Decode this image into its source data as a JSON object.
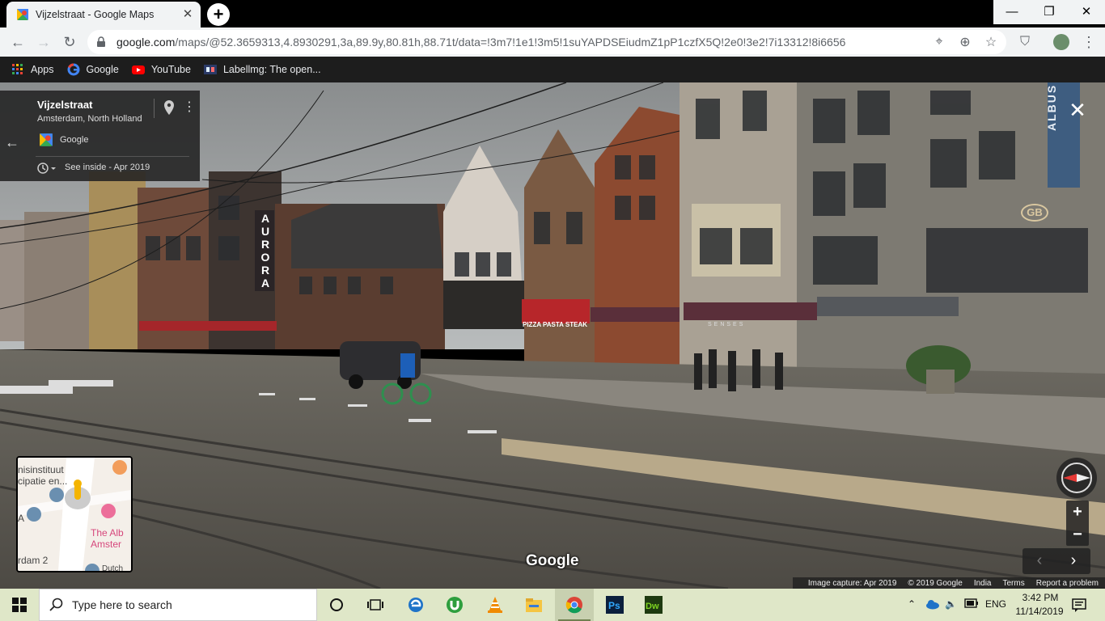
{
  "browser": {
    "tab_title": "Vijzelstraat - Google Maps",
    "tab_close": "✕",
    "new_tab": "+",
    "url_host": "google.com",
    "url_path": "/maps/@52.3659313,4.8930291,3a,89.9y,80.81h,88.71t/data=!3m7!1e1!3m5!1suYAPDSEiudmZ1pP1czfX5Q!2e0!3e2!7i13312!8i6656",
    "window": {
      "minimize": "—",
      "maximize": "❐",
      "close": "✕"
    },
    "bookmarks": [
      "Apps",
      "Google",
      "YouTube",
      "Labellmg: The open..."
    ]
  },
  "place_card": {
    "title": "Vijzelstraat",
    "subtitle": "Amsterdam, North Holland",
    "provider": "Google",
    "history": "See inside - Apr 2019"
  },
  "storefronts": {
    "aurora": [
      "A",
      "U",
      "R",
      "O",
      "R",
      "A"
    ],
    "albus": "ALBUS",
    "gb": "GB",
    "pizza": "PIZZA PASTA STEAK",
    "senses": "SENSES"
  },
  "minimap": {
    "labels": [
      "nisinstituut",
      "cipatie en...",
      "The Alb",
      "Amster",
      "rdam 2",
      "A",
      "Dutch"
    ]
  },
  "controls": {
    "zoom_in": "+",
    "zoom_out": "−",
    "pan_left": "‹",
    "pan_right": "›",
    "close": "✕"
  },
  "watermark": "Google",
  "footer": [
    "Image capture: Apr 2019",
    "© 2019 Google",
    "India",
    "Terms",
    "Report a problem"
  ],
  "taskbar": {
    "search_placeholder": "Type here to search",
    "language": "ENG",
    "time": "3:42 PM",
    "date": "11/14/2019"
  }
}
